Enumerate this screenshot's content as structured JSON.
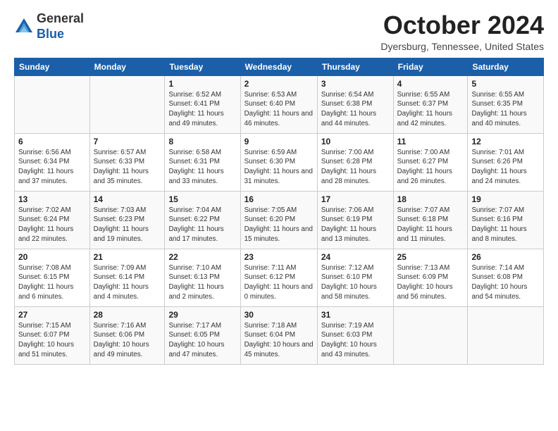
{
  "logo": {
    "general": "General",
    "blue": "Blue"
  },
  "header": {
    "month": "October 2024",
    "location": "Dyersburg, Tennessee, United States"
  },
  "days_of_week": [
    "Sunday",
    "Monday",
    "Tuesday",
    "Wednesday",
    "Thursday",
    "Friday",
    "Saturday"
  ],
  "weeks": [
    [
      {
        "day": "",
        "info": ""
      },
      {
        "day": "",
        "info": ""
      },
      {
        "day": "1",
        "info": "Sunrise: 6:52 AM\nSunset: 6:41 PM\nDaylight: 11 hours and 49 minutes."
      },
      {
        "day": "2",
        "info": "Sunrise: 6:53 AM\nSunset: 6:40 PM\nDaylight: 11 hours and 46 minutes."
      },
      {
        "day": "3",
        "info": "Sunrise: 6:54 AM\nSunset: 6:38 PM\nDaylight: 11 hours and 44 minutes."
      },
      {
        "day": "4",
        "info": "Sunrise: 6:55 AM\nSunset: 6:37 PM\nDaylight: 11 hours and 42 minutes."
      },
      {
        "day": "5",
        "info": "Sunrise: 6:55 AM\nSunset: 6:35 PM\nDaylight: 11 hours and 40 minutes."
      }
    ],
    [
      {
        "day": "6",
        "info": "Sunrise: 6:56 AM\nSunset: 6:34 PM\nDaylight: 11 hours and 37 minutes."
      },
      {
        "day": "7",
        "info": "Sunrise: 6:57 AM\nSunset: 6:33 PM\nDaylight: 11 hours and 35 minutes."
      },
      {
        "day": "8",
        "info": "Sunrise: 6:58 AM\nSunset: 6:31 PM\nDaylight: 11 hours and 33 minutes."
      },
      {
        "day": "9",
        "info": "Sunrise: 6:59 AM\nSunset: 6:30 PM\nDaylight: 11 hours and 31 minutes."
      },
      {
        "day": "10",
        "info": "Sunrise: 7:00 AM\nSunset: 6:28 PM\nDaylight: 11 hours and 28 minutes."
      },
      {
        "day": "11",
        "info": "Sunrise: 7:00 AM\nSunset: 6:27 PM\nDaylight: 11 hours and 26 minutes."
      },
      {
        "day": "12",
        "info": "Sunrise: 7:01 AM\nSunset: 6:26 PM\nDaylight: 11 hours and 24 minutes."
      }
    ],
    [
      {
        "day": "13",
        "info": "Sunrise: 7:02 AM\nSunset: 6:24 PM\nDaylight: 11 hours and 22 minutes."
      },
      {
        "day": "14",
        "info": "Sunrise: 7:03 AM\nSunset: 6:23 PM\nDaylight: 11 hours and 19 minutes."
      },
      {
        "day": "15",
        "info": "Sunrise: 7:04 AM\nSunset: 6:22 PM\nDaylight: 11 hours and 17 minutes."
      },
      {
        "day": "16",
        "info": "Sunrise: 7:05 AM\nSunset: 6:20 PM\nDaylight: 11 hours and 15 minutes."
      },
      {
        "day": "17",
        "info": "Sunrise: 7:06 AM\nSunset: 6:19 PM\nDaylight: 11 hours and 13 minutes."
      },
      {
        "day": "18",
        "info": "Sunrise: 7:07 AM\nSunset: 6:18 PM\nDaylight: 11 hours and 11 minutes."
      },
      {
        "day": "19",
        "info": "Sunrise: 7:07 AM\nSunset: 6:16 PM\nDaylight: 11 hours and 8 minutes."
      }
    ],
    [
      {
        "day": "20",
        "info": "Sunrise: 7:08 AM\nSunset: 6:15 PM\nDaylight: 11 hours and 6 minutes."
      },
      {
        "day": "21",
        "info": "Sunrise: 7:09 AM\nSunset: 6:14 PM\nDaylight: 11 hours and 4 minutes."
      },
      {
        "day": "22",
        "info": "Sunrise: 7:10 AM\nSunset: 6:13 PM\nDaylight: 11 hours and 2 minutes."
      },
      {
        "day": "23",
        "info": "Sunrise: 7:11 AM\nSunset: 6:12 PM\nDaylight: 11 hours and 0 minutes."
      },
      {
        "day": "24",
        "info": "Sunrise: 7:12 AM\nSunset: 6:10 PM\nDaylight: 10 hours and 58 minutes."
      },
      {
        "day": "25",
        "info": "Sunrise: 7:13 AM\nSunset: 6:09 PM\nDaylight: 10 hours and 56 minutes."
      },
      {
        "day": "26",
        "info": "Sunrise: 7:14 AM\nSunset: 6:08 PM\nDaylight: 10 hours and 54 minutes."
      }
    ],
    [
      {
        "day": "27",
        "info": "Sunrise: 7:15 AM\nSunset: 6:07 PM\nDaylight: 10 hours and 51 minutes."
      },
      {
        "day": "28",
        "info": "Sunrise: 7:16 AM\nSunset: 6:06 PM\nDaylight: 10 hours and 49 minutes."
      },
      {
        "day": "29",
        "info": "Sunrise: 7:17 AM\nSunset: 6:05 PM\nDaylight: 10 hours and 47 minutes."
      },
      {
        "day": "30",
        "info": "Sunrise: 7:18 AM\nSunset: 6:04 PM\nDaylight: 10 hours and 45 minutes."
      },
      {
        "day": "31",
        "info": "Sunrise: 7:19 AM\nSunset: 6:03 PM\nDaylight: 10 hours and 43 minutes."
      },
      {
        "day": "",
        "info": ""
      },
      {
        "day": "",
        "info": ""
      }
    ]
  ]
}
